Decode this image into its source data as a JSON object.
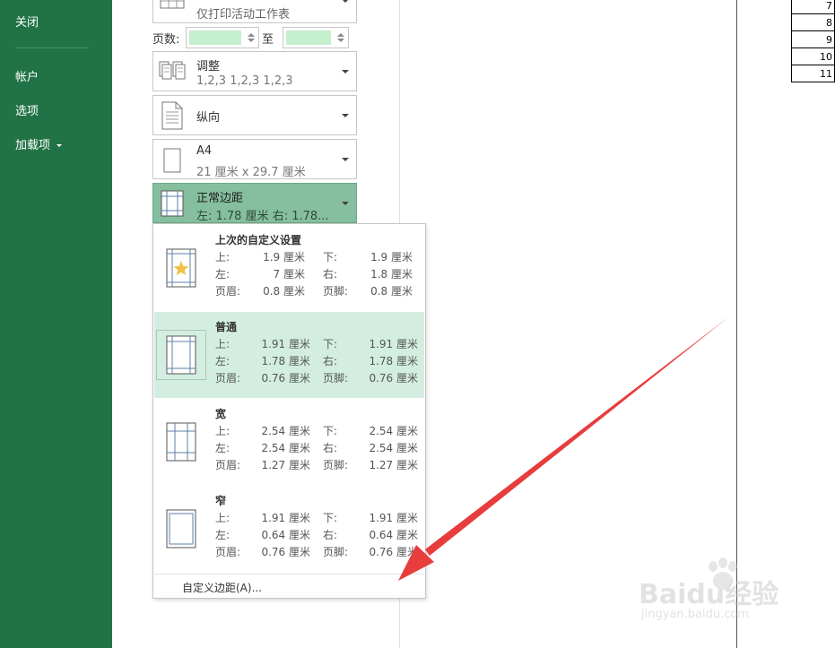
{
  "sidebar": {
    "close": "关闭",
    "account": "帐户",
    "options": "选项",
    "addins": "加载项"
  },
  "settings": {
    "print_what": "仅打印活动工作表",
    "pages_label": "页数:",
    "to_label": "至",
    "collate": {
      "title": "调整",
      "subtitle": "1,2,3    1,2,3    1,2,3"
    },
    "orientation": {
      "title": "纵向"
    },
    "paper": {
      "title": "A4",
      "subtitle": "21 厘米 x 29.7 厘米"
    },
    "margins": {
      "title": "正常边距",
      "subtitle": "左:  1.78 厘米    右:  1.78..."
    }
  },
  "margins_menu": {
    "options": [
      {
        "name": "上次的自定义设置",
        "top_label": "上:",
        "top": "1.9 厘米",
        "bottom_label": "下:",
        "bottom": "1.9 厘米",
        "left_label": "左:",
        "left": "7 厘米",
        "right_label": "右:",
        "right": "1.8 厘米",
        "header_label": "页眉:",
        "header": "0.8 厘米",
        "footer_label": "页脚:",
        "footer": "0.8 厘米"
      },
      {
        "name": "普通",
        "top_label": "上:",
        "top": "1.91 厘米",
        "bottom_label": "下:",
        "bottom": "1.91 厘米",
        "left_label": "左:",
        "left": "1.78 厘米",
        "right_label": "右:",
        "right": "1.78 厘米",
        "header_label": "页眉:",
        "header": "0.76 厘米",
        "footer_label": "页脚:",
        "footer": "0.76 厘米"
      },
      {
        "name": "宽",
        "top_label": "上:",
        "top": "2.54 厘米",
        "bottom_label": "下:",
        "bottom": "2.54 厘米",
        "left_label": "左:",
        "left": "2.54 厘米",
        "right_label": "右:",
        "right": "2.54 厘米",
        "header_label": "页眉:",
        "header": "1.27 厘米",
        "footer_label": "页脚:",
        "footer": "1.27 厘米"
      },
      {
        "name": "窄",
        "top_label": "上:",
        "top": "1.91 厘米",
        "bottom_label": "下:",
        "bottom": "1.91 厘米",
        "left_label": "左:",
        "left": "0.64 厘米",
        "right_label": "右:",
        "right": "0.64 厘米",
        "header_label": "页眉:",
        "header": "0.76 厘米",
        "footer_label": "页脚:",
        "footer": "0.76 厘米"
      }
    ],
    "custom": "自定义边距(A)..."
  },
  "preview_table": [
    "7",
    "8",
    "9",
    "10",
    "11"
  ],
  "watermark": {
    "brand": "Baidu经验",
    "url": "jingyan.baidu.com"
  },
  "colors": {
    "sidebar": "#217346",
    "selected": "#d3eee0",
    "active_control": "#86bf9f",
    "annotation_arrow": "#e83d3d"
  }
}
